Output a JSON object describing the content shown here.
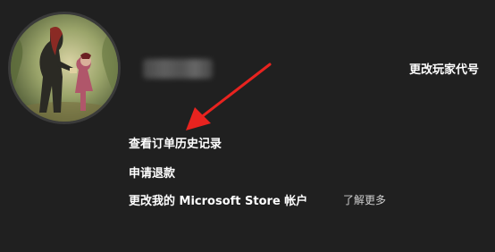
{
  "profile": {
    "avatar_icon": "avatar-mother-child-illustration",
    "gamertag_blurred": true,
    "change_gamertag_label": "更改玩家代号"
  },
  "menu": {
    "order_history_label": "查看订单历史记录",
    "refund_label": "申请退款",
    "store_account_label": "更改我的 Microsoft Store 帐户",
    "learn_more_label": "了解更多"
  },
  "annotation": {
    "arrow_color": "#e8231f"
  }
}
